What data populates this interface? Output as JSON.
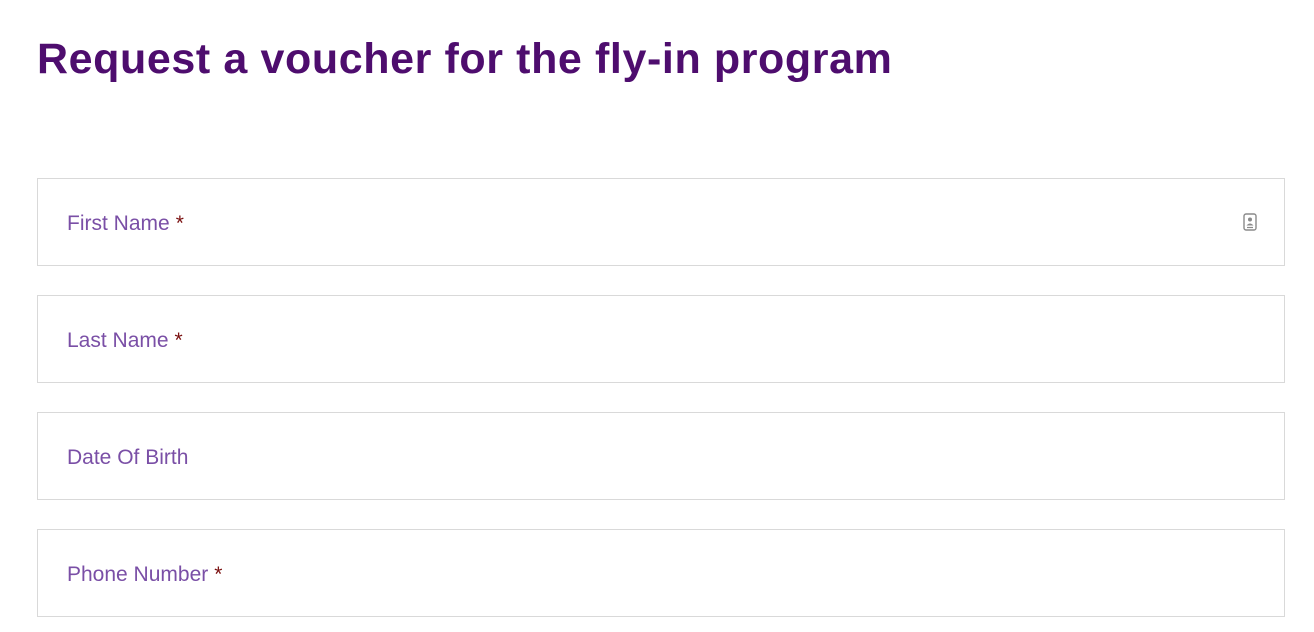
{
  "page": {
    "title": "Request a voucher for the fly-in program"
  },
  "form": {
    "fields": [
      {
        "label": "First Name",
        "required_marker": "*",
        "value": "",
        "icon": "contact-card-icon"
      },
      {
        "label": "Last Name",
        "required_marker": "*",
        "value": ""
      },
      {
        "label": "Date Of Birth",
        "required_marker": "",
        "value": ""
      },
      {
        "label": "Phone Number",
        "required_marker": "*",
        "value": ""
      }
    ]
  },
  "colors": {
    "title": "#4e0d6e",
    "label": "#7a4fa6",
    "required_marker": "#7a1010",
    "field_border": "#d9d9d9"
  }
}
